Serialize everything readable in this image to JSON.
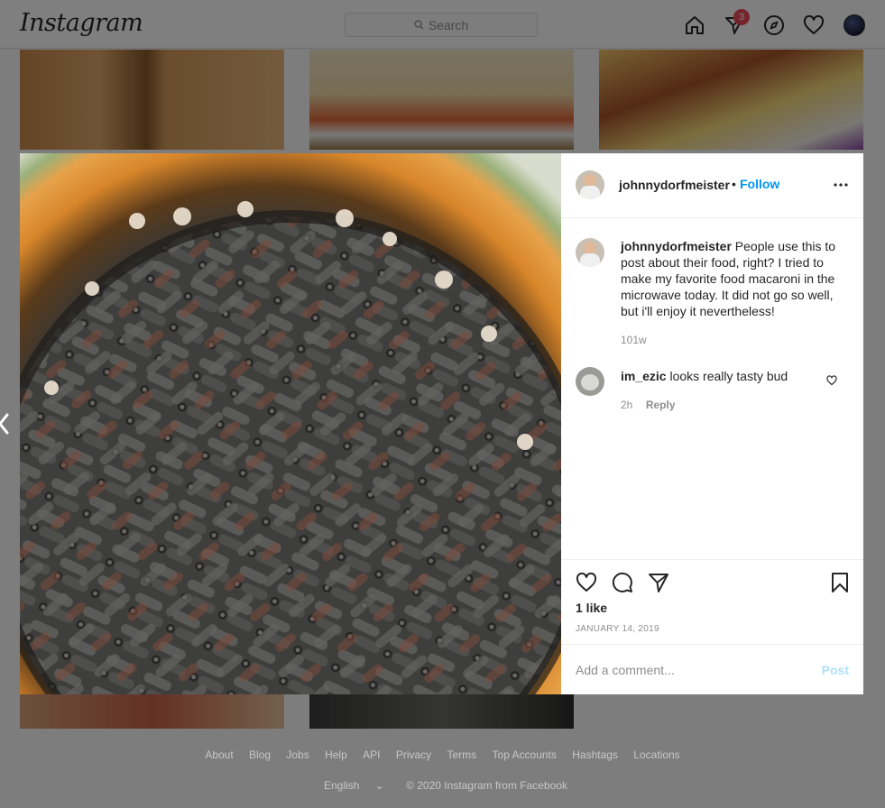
{
  "nav": {
    "logo": "Instagram",
    "search_placeholder": "Search",
    "activity_badge": "3"
  },
  "post": {
    "author": "johnnydorfmeister",
    "follow_separator": "•",
    "follow_label": "Follow",
    "caption_user": "johnnydorfmeister",
    "caption_text": "People use this to post about their food, right? I tried to make my favorite food macaroni in the microwave today. It did not go so well, but i'll enjoy it nevertheless!",
    "caption_time": "101w",
    "comments": [
      {
        "user": "im_ezic",
        "text": "looks really tasty bud",
        "time": "2h",
        "reply_label": "Reply"
      }
    ],
    "likes": "1 like",
    "date": "JANUARY 14, 2019",
    "add_comment_placeholder": "Add a comment...",
    "post_button": "Post"
  },
  "footer": {
    "links": [
      "About",
      "Blog",
      "Jobs",
      "Help",
      "API",
      "Privacy",
      "Terms",
      "Top Accounts",
      "Hashtags",
      "Locations"
    ],
    "language": "English",
    "copyright": "© 2020 Instagram from Facebook"
  },
  "colors": {
    "accent": "#0095f6",
    "badge": "#ed4956",
    "post_disabled": "#b2dffc"
  },
  "icons": [
    "search-icon",
    "home-icon",
    "direct-icon",
    "explore-icon",
    "heart-icon",
    "more-icon",
    "comment-icon",
    "share-icon",
    "bookmark-icon",
    "chevron-left-icon"
  ]
}
